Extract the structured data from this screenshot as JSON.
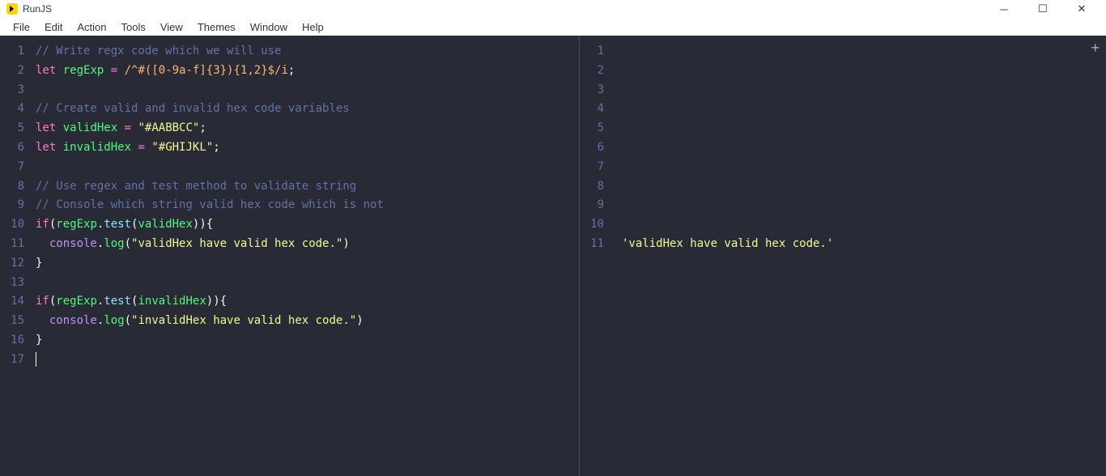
{
  "window": {
    "title": "RunJS"
  },
  "menu": {
    "items": [
      "File",
      "Edit",
      "Action",
      "Tools",
      "View",
      "Themes",
      "Window",
      "Help"
    ]
  },
  "editor": {
    "lineCount": 17,
    "lines": {
      "1": {
        "type": "comment",
        "text": "// Write regx code which we will use"
      },
      "2": {
        "keyword": "let",
        "var": "regExp",
        "op": "=",
        "regex": "/^#([0-9a-f]{3}){1,2}$/i",
        "end": ";"
      },
      "3": {
        "type": "empty"
      },
      "4": {
        "type": "comment",
        "text": "// Create valid and invalid hex code variables"
      },
      "5": {
        "keyword": "let",
        "var": "validHex",
        "op": "=",
        "string": "\"#AABBCC\"",
        "end": ";"
      },
      "6": {
        "keyword": "let",
        "var": "invalidHex",
        "op": "=",
        "string": "\"#GHIJKL\"",
        "end": ";"
      },
      "7": {
        "type": "empty"
      },
      "8": {
        "type": "comment",
        "text": "// Use regex and test method to validate string"
      },
      "9": {
        "type": "comment",
        "text": "// Console which string valid hex code which is not"
      },
      "10": {
        "kw": "if",
        "call1": "regExp",
        "method1": "test",
        "arg1": "validHex",
        "close": "){"
      },
      "11": {
        "indent": "  ",
        "obj": "console",
        "method": "log",
        "string": "\"validHex have valid hex code.\"",
        "close": ")"
      },
      "12": {
        "text": "}"
      },
      "13": {
        "type": "empty"
      },
      "14": {
        "kw": "if",
        "call1": "regExp",
        "method1": "test",
        "arg1": "invalidHex",
        "close": "){"
      },
      "15": {
        "indent": "  ",
        "obj": "console",
        "method": "log",
        "string": "\"invalidHex have valid hex code.\"",
        "close": ")"
      },
      "16": {
        "text": "}"
      },
      "17": {
        "type": "empty"
      }
    }
  },
  "output": {
    "lineCount": 11,
    "lines": {
      "11": "'validHex have valid hex code.'"
    }
  }
}
